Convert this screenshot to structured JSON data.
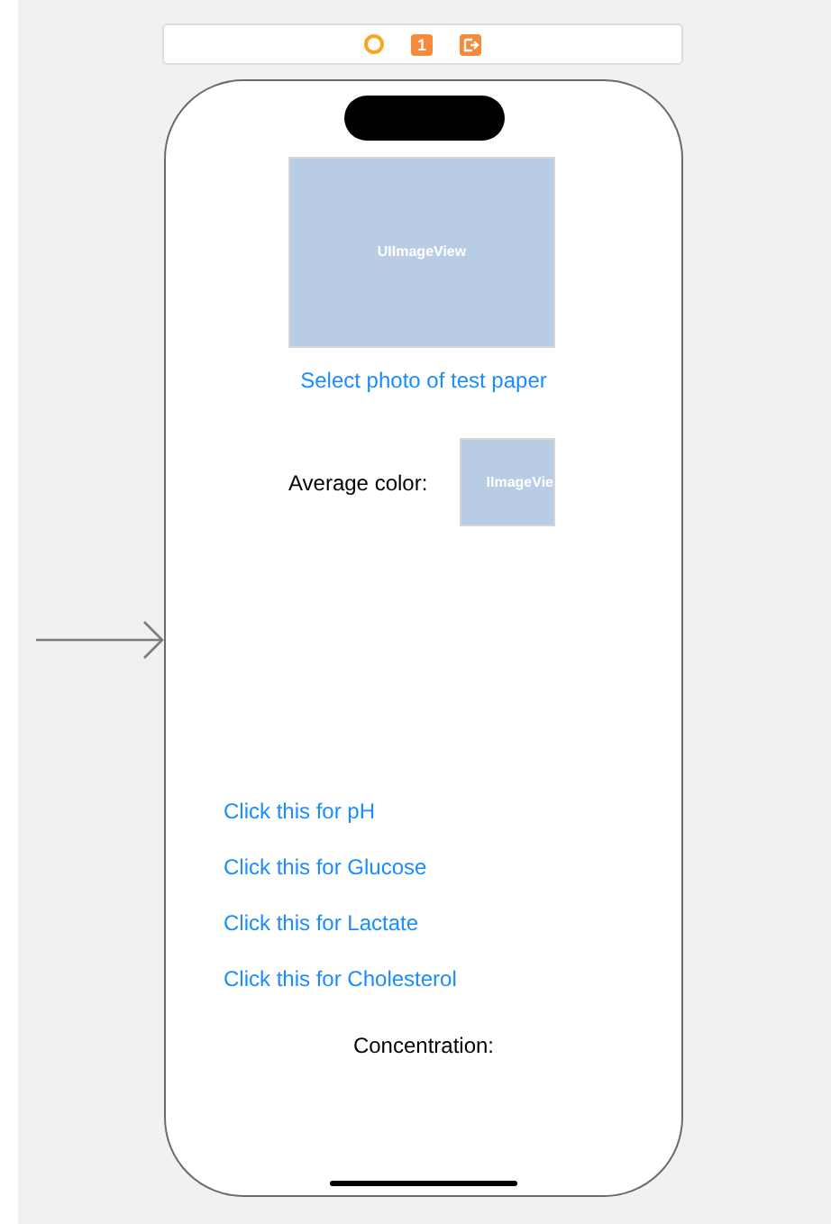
{
  "scene_dock": {
    "icons": [
      {
        "kind": "controller"
      },
      {
        "kind": "first_responder",
        "text": "1"
      },
      {
        "kind": "exit"
      }
    ]
  },
  "main_image": {
    "label": "UIImageView"
  },
  "select_photo_button": "Select photo of test paper",
  "average_color": {
    "label": "Average color:",
    "image_label": "IImageVie"
  },
  "test_buttons": [
    "Click this for pH",
    "Click this for Glucose",
    "Click this for Lactate",
    "Click this for Cholesterol"
  ],
  "concentration_label": "Concentration:"
}
